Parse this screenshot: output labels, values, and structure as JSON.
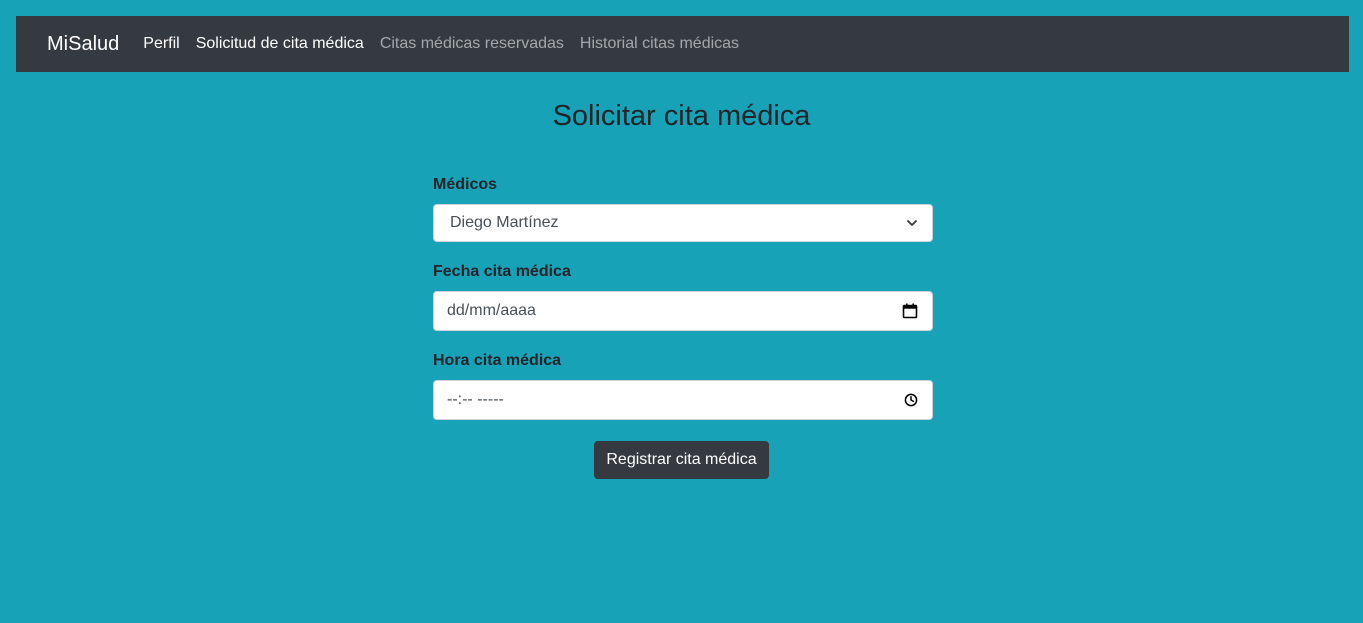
{
  "navbar": {
    "brand": "MiSalud",
    "links": [
      {
        "label": "Perfil",
        "state": "active"
      },
      {
        "label": "Solicitud de cita médica",
        "state": "active"
      },
      {
        "label": "Citas médicas reservadas",
        "state": "muted"
      },
      {
        "label": "Historial citas médicas",
        "state": "muted"
      }
    ]
  },
  "page": {
    "title": "Solicitar cita médica"
  },
  "form": {
    "doctor": {
      "label": "Médicos",
      "selected": "Diego Martínez"
    },
    "date": {
      "label": "Fecha cita médica",
      "placeholder": "dd/mm/aaaa"
    },
    "time": {
      "label": "Hora cita médica",
      "placeholder": "--:-- -----"
    },
    "submit_label": "Registrar cita médica"
  },
  "icons": {
    "select_arrow": "chevron-down-icon",
    "date_picker": "calendar-icon",
    "time_picker": "clock-icon"
  },
  "colors": {
    "background": "#17a2b8",
    "navbar": "#343a40",
    "button": "#343a40"
  }
}
